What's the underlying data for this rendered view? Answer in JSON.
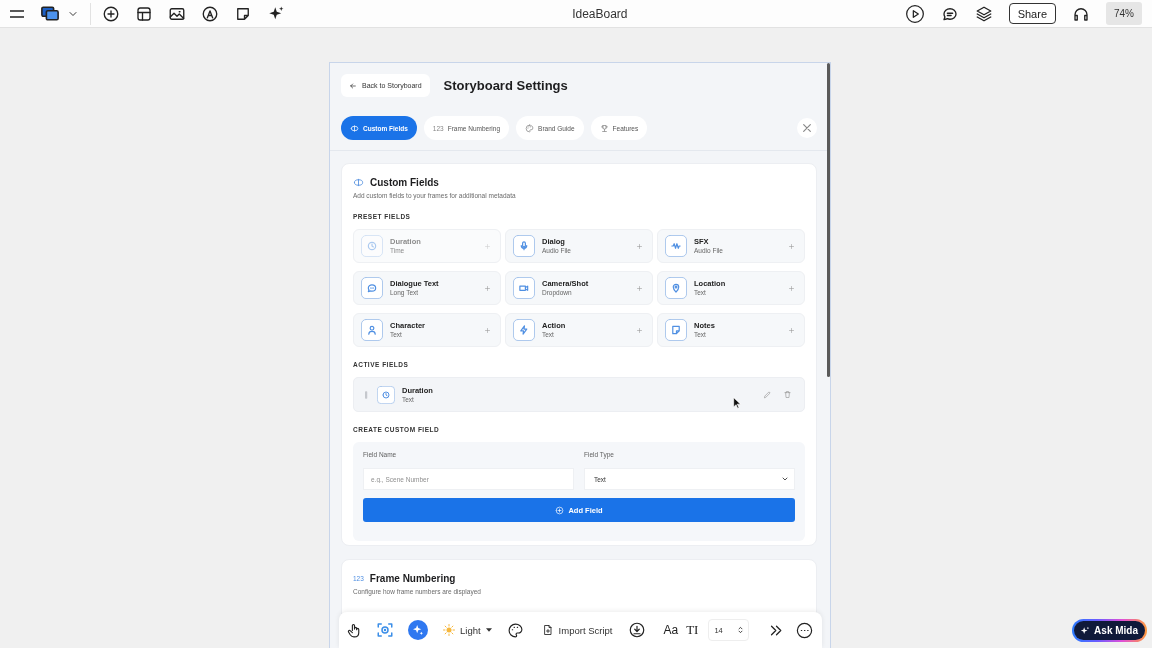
{
  "top_bar": {
    "title": "IdeaBoard",
    "share": "Share",
    "zoom": "74%"
  },
  "settings": {
    "back": "Back to Storyboard",
    "title": "Storyboard Settings",
    "tabs": [
      {
        "label": "Custom Fields",
        "selected": true
      },
      {
        "label": "Frame Numbering",
        "selected": false,
        "glyph": "123"
      },
      {
        "label": "Brand Guide",
        "selected": false
      },
      {
        "label": "Features",
        "selected": false
      }
    ]
  },
  "custom_fields": {
    "title": "Custom Fields",
    "subtitle": "Add custom fields to your frames for additional metadata",
    "preset_heading": "PRESET FIELDS",
    "presets": [
      {
        "name": "Duration",
        "type": "Time",
        "disabled": true
      },
      {
        "name": "Dialog",
        "type": "Audio File",
        "disabled": false
      },
      {
        "name": "SFX",
        "type": "Audio File",
        "disabled": false
      },
      {
        "name": "Dialogue Text",
        "type": "Long Text",
        "disabled": false
      },
      {
        "name": "Camera/Shot",
        "type": "Dropdown",
        "disabled": false
      },
      {
        "name": "Location",
        "type": "Text",
        "disabled": false
      },
      {
        "name": "Character",
        "type": "Text",
        "disabled": false
      },
      {
        "name": "Action",
        "type": "Text",
        "disabled": false
      },
      {
        "name": "Notes",
        "type": "Text",
        "disabled": false
      }
    ],
    "active_heading": "ACTIVE FIELDS",
    "active": [
      {
        "name": "Duration",
        "type": "Text"
      }
    ],
    "create_heading": "CREATE CUSTOM FIELD",
    "name_field": {
      "label": "Field Name",
      "placeholder": "e.g., Scene Number"
    },
    "type_field": {
      "label": "Field Type",
      "value": "Text"
    },
    "add_button": "Add Field"
  },
  "frame_numbering": {
    "glyph": "123",
    "title": "Frame Numbering",
    "subtitle": "Configure how frame numbers are displayed"
  },
  "toolbar": {
    "theme": "Light",
    "import": "Import Script",
    "font_glyph": "Aa",
    "size_glyph": "TI",
    "font_size": "14"
  },
  "ask_button": "Ask Mida"
}
